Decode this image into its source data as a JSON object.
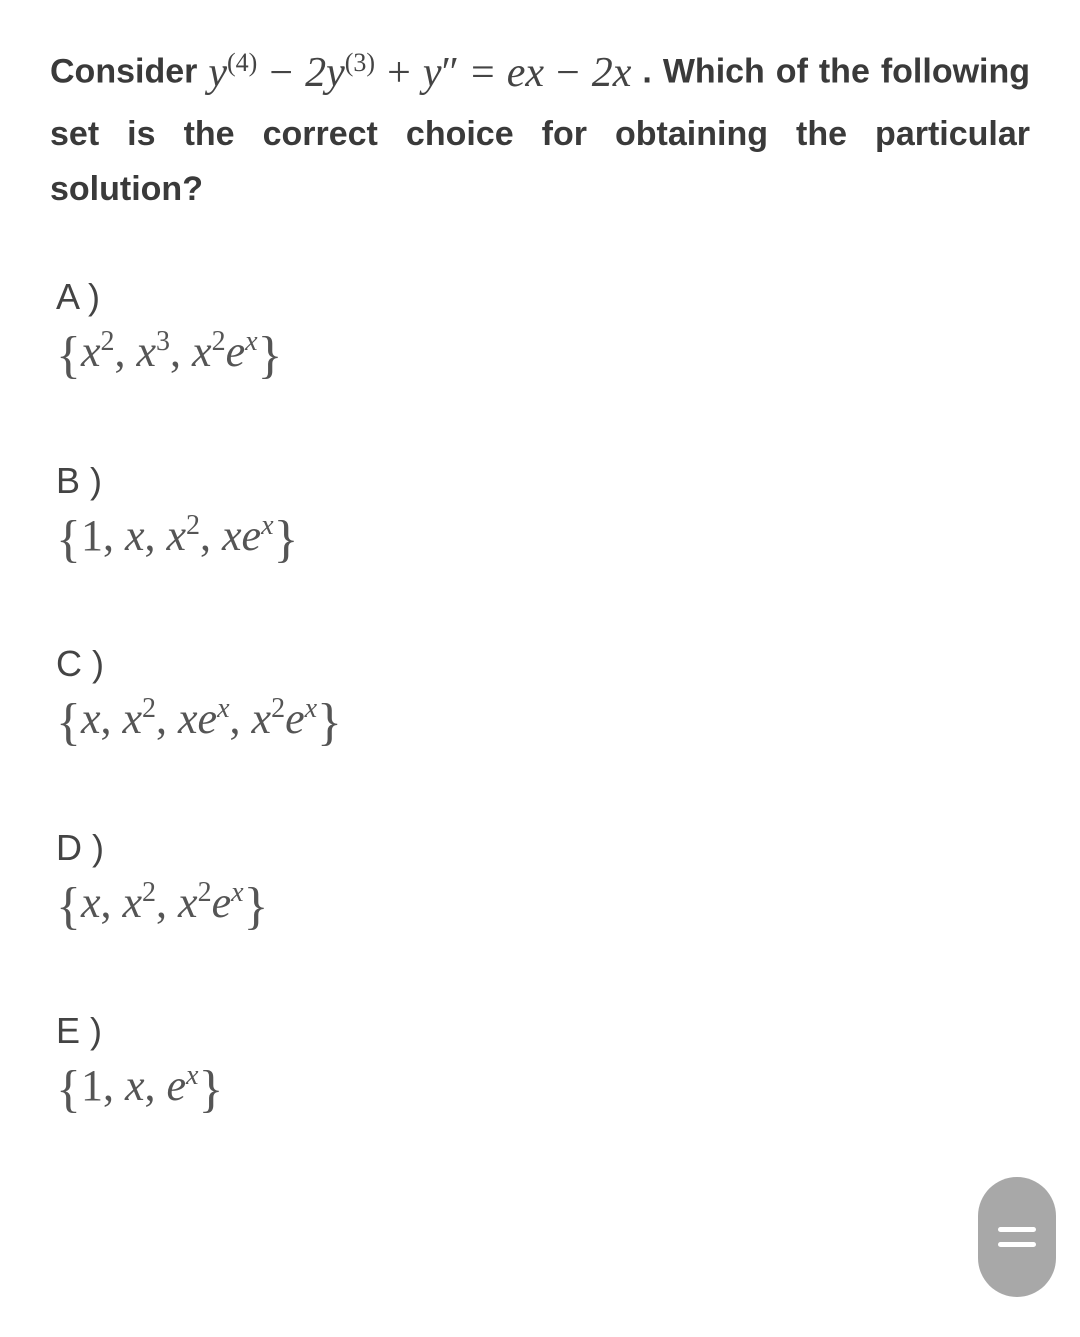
{
  "question": {
    "prefix": "Consider ",
    "equation_html": "<span class='it'>y</span><span class='sup'>(4)</span> <span class='op'>−</span> 2<span class='it'>y</span><span class='sup'>(3)</span> <span class='op'>+</span> <span class='it'>y</span><span class='op'>″</span> <span class='op'>=</span> <span class='it'>e</span><span class='supit'>x</span> <span class='op'>−</span> 2<span class='it'>x</span>",
    "suffix": " . Which of the following set is the correct choice for obtaining the particular solution?",
    "equation_plain": "y^(4) − 2y^(3) + y″ = e^x − 2x"
  },
  "options": [
    {
      "label": "A )",
      "set_html": "<span class='brace'>{</span><span class='it'>x</span><span class='sup'>2</span>, <span class='it'>x</span><span class='sup'>3</span>, <span class='it'>x</span><span class='sup'>2</span><span class='it'>e</span><span class='supit'>x</span><span class='brace'>}</span>",
      "set_plain": "{x^2, x^3, x^2 e^x}"
    },
    {
      "label": "B )",
      "set_html": "<span class='brace'>{</span>1, <span class='it'>x</span>, <span class='it'>x</span><span class='sup'>2</span>, <span class='it'>xe</span><span class='supit'>x</span><span class='brace'>}</span>",
      "set_plain": "{1, x, x^2, x e^x}"
    },
    {
      "label": "C )",
      "set_html": "<span class='brace'>{</span><span class='it'>x</span>, <span class='it'>x</span><span class='sup'>2</span>, <span class='it'>xe</span><span class='supit'>x</span>, <span class='it'>x</span><span class='sup'>2</span><span class='it'>e</span><span class='supit'>x</span><span class='brace'>}</span>",
      "set_plain": "{x, x^2, x e^x, x^2 e^x}"
    },
    {
      "label": "D )",
      "set_html": "<span class='brace'>{</span><span class='it'>x</span>, <span class='it'>x</span><span class='sup'>2</span>, <span class='it'>x</span><span class='sup'>2</span><span class='it'>e</span><span class='supit'>x</span><span class='brace'>}</span>",
      "set_plain": "{x, x^2, x^2 e^x}"
    },
    {
      "label": "E )",
      "set_html": "<span class='brace'>{</span>1, <span class='it'>x</span>, <span class='it'>e</span><span class='supit'>x</span><span class='brace'>}</span>",
      "set_plain": "{1, x, e^x}"
    }
  ],
  "fab": {
    "aria": "menu"
  }
}
